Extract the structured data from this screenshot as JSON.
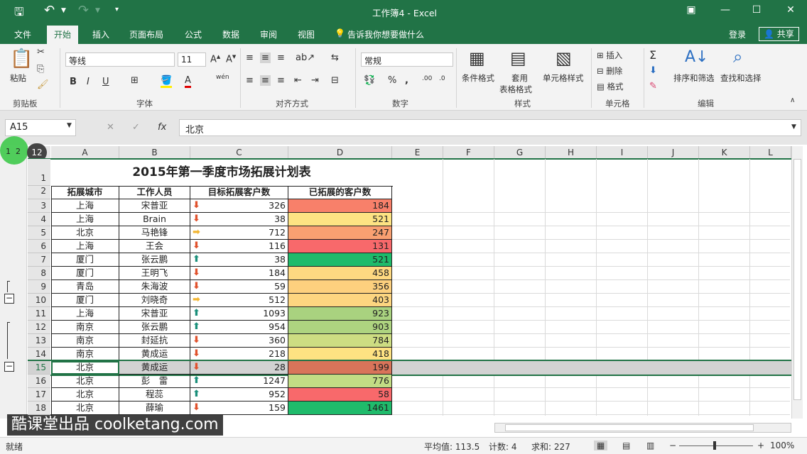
{
  "window": {
    "title": "工作簿4 - Excel"
  },
  "qat": {
    "undo": "↶",
    "redo": "↷"
  },
  "tabs": [
    "文件",
    "开始",
    "插入",
    "页面布局",
    "公式",
    "数据",
    "审阅",
    "视图"
  ],
  "tell_me": "告诉我你想要做什么",
  "login": "登录",
  "share": "共享",
  "ribbon": {
    "paste": "粘贴",
    "clipboard": "剪贴板",
    "font_name": "等线",
    "font_size": "11",
    "font_group": "字体",
    "align_group": "对齐方式",
    "number_format": "常规",
    "number_group": "数字",
    "cond_format": "条件格式",
    "table_format_1": "套用",
    "table_format_2": "表格格式",
    "cell_style": "单元格样式",
    "style_group": "样式",
    "insert": "插入",
    "delete": "删除",
    "format": "格式",
    "cells_group": "单元格",
    "sort_filter": "排序和筛选",
    "find_select": "查找和选择",
    "edit_group": "编辑",
    "bold": "B",
    "italic": "I",
    "underline": "U",
    "wen": "wén"
  },
  "formula_bar": {
    "name_box": "A15",
    "fx": "fx",
    "value": "北京"
  },
  "outline_levels": [
    "1",
    "2"
  ],
  "columns": [
    "A",
    "B",
    "C",
    "D",
    "E",
    "F",
    "G",
    "H",
    "I",
    "J",
    "K",
    "L"
  ],
  "sheet": {
    "title": "2015年第一季度市场拓展计划表",
    "headers": [
      "拓展城市",
      "工作人员",
      "目标拓展客户数",
      "已拓展的客户数"
    ],
    "rows": [
      {
        "r": "3",
        "city": "上海",
        "person": "宋普亚",
        "target": "326",
        "done": "184",
        "icon": "down",
        "color": "#f8806a"
      },
      {
        "r": "4",
        "city": "上海",
        "person": "Brain",
        "target": "38",
        "done": "521",
        "icon": "down",
        "color": "#fde383"
      },
      {
        "r": "5",
        "city": "北京",
        "person": "马艳锋",
        "target": "712",
        "done": "247",
        "icon": "right",
        "color": "#f9a071"
      },
      {
        "r": "6",
        "city": "上海",
        "person": "王会",
        "target": "116",
        "done": "131",
        "icon": "down",
        "color": "#f8696b"
      },
      {
        "r": "7",
        "city": "厦门",
        "person": "张云鹏",
        "target": "38",
        "done": "521",
        "icon": "up",
        "color": "#1fbb6b"
      },
      {
        "r": "8",
        "city": "厦门",
        "person": "王明飞",
        "target": "184",
        "done": "458",
        "icon": "down",
        "color": "#fed981"
      },
      {
        "r": "9",
        "city": "青岛",
        "person": "朱海波",
        "target": "59",
        "done": "356",
        "icon": "down",
        "color": "#fdd07e"
      },
      {
        "r": "10",
        "city": "厦门",
        "person": "刘晓奇",
        "target": "512",
        "done": "403",
        "icon": "right",
        "color": "#fdd580"
      },
      {
        "r": "11",
        "city": "上海",
        "person": "宋普亚",
        "target": "1093",
        "done": "923",
        "icon": "up",
        "color": "#a9d27f"
      },
      {
        "r": "12",
        "city": "南京",
        "person": "张云鹏",
        "target": "954",
        "done": "903",
        "icon": "up",
        "color": "#aed480"
      },
      {
        "r": "13",
        "city": "南京",
        "person": "封延抗",
        "target": "360",
        "done": "784",
        "icon": "down",
        "color": "#cddd82"
      },
      {
        "r": "14",
        "city": "南京",
        "person": "黄成运",
        "target": "218",
        "done": "418",
        "icon": "down",
        "color": "#fee282"
      },
      {
        "r": "15",
        "city": "北京",
        "person": "黄成运",
        "target": "28",
        "done": "199",
        "icon": "down",
        "color": "#d9745a"
      },
      {
        "r": "16",
        "city": "北京",
        "person": "彭　雷",
        "target": "1247",
        "done": "776",
        "icon": "up",
        "color": "#c2dc84"
      },
      {
        "r": "17",
        "city": "北京",
        "person": "程蕊",
        "target": "952",
        "done": "58",
        "icon": "up",
        "color": "#f8696b"
      },
      {
        "r": "18",
        "city": "北京",
        "person": "薛瑜",
        "target": "159",
        "done": "1461",
        "icon": "down",
        "color": "#1fbb6b"
      }
    ]
  },
  "status": {
    "ready": "就绪",
    "average": "平均值: 113.5",
    "count": "计数: 4",
    "sum": "求和: 227",
    "zoom": "100%"
  },
  "watermark": "酷课堂出品 coolketang.com",
  "colors": {
    "excel_green": "#217346",
    "up_arrow": "#1a8f7a",
    "down_arrow": "#e0522d",
    "right_arrow": "#f2b531"
  }
}
